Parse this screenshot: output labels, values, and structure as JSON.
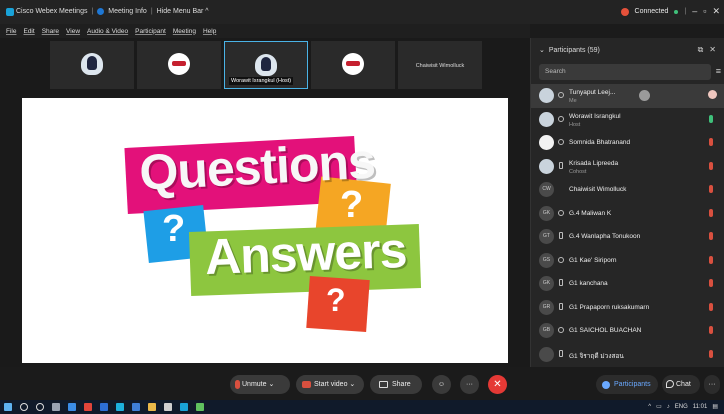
{
  "titlebar": {
    "app_title": "Cisco Webex Meetings",
    "meeting_info": "Meeting Info",
    "hide_menu": "Hide Menu Bar ^",
    "status": "Connected",
    "win_min": "–",
    "win_max": "▫",
    "win_close": "✕"
  },
  "menubar": [
    "File",
    "Edit",
    "Share",
    "View",
    "Audio & Video",
    "Participant",
    "Meeting",
    "Help"
  ],
  "video_strip": {
    "tiles": [
      {
        "kind": "person",
        "label": ""
      },
      {
        "kind": "logo",
        "label": ""
      },
      {
        "kind": "person",
        "label": "Worawit Israngkul  (Host)"
      },
      {
        "kind": "logo",
        "label": ""
      },
      {
        "kind": "name",
        "label": "Chaiwisit Wimolluck"
      }
    ]
  },
  "slide": {
    "word1": "Questions",
    "word2": "Answers",
    "mark": "?"
  },
  "participants": {
    "header": "Participants (59)",
    "search_placeholder": "Search",
    "items": [
      {
        "initials": "",
        "name": "Tunyaput Leej...",
        "sub": "Me",
        "avatar": "photo"
      },
      {
        "initials": "",
        "name": "Worawit Israngkul",
        "sub": "Host",
        "avatar": "photo"
      },
      {
        "initials": "",
        "name": "Somnida Bhatranand",
        "sub": "",
        "avatar": "logo"
      },
      {
        "initials": "",
        "name": "Krisada Lipreeda",
        "sub": "Cohost",
        "avatar": "photo"
      },
      {
        "initials": "CW",
        "name": "Chaiwisit Wimolluck",
        "sub": "",
        "avatar": "initials"
      },
      {
        "initials": "GK",
        "name": "G.4 Maliwan K",
        "sub": "",
        "avatar": "initials"
      },
      {
        "initials": "GT",
        "name": "G.4 Wanlapha Tonukoon",
        "sub": "",
        "avatar": "initials"
      },
      {
        "initials": "GS",
        "name": "G1 Kae' Siriporn",
        "sub": "",
        "avatar": "initials"
      },
      {
        "initials": "GK",
        "name": "G1 kanchana",
        "sub": "",
        "avatar": "initials"
      },
      {
        "initials": "GR",
        "name": "G1 Prapaporn ruksakumarn",
        "sub": "",
        "avatar": "initials"
      },
      {
        "initials": "GB",
        "name": "G1 SAICHOL BUACHAN",
        "sub": "",
        "avatar": "initials"
      },
      {
        "initials": "",
        "name": "G1 จิราฤดี ม่วงสอน",
        "sub": "",
        "avatar": "initials"
      }
    ]
  },
  "controls": {
    "unmute": "Unmute",
    "start_video": "Start video",
    "share": "Share",
    "more": "···",
    "end": "✕",
    "participants": "Participants",
    "chat": "Chat",
    "more_right": "···"
  },
  "taskbar": {
    "lang": "ENG",
    "time": "11:01"
  },
  "colors": {
    "accent": "#4ab3e6",
    "end_call": "#e53935",
    "muted": "#d9503f",
    "q_pink": "#e3117a",
    "a_green": "#8dc63f",
    "q_orange": "#f5a623",
    "q_blue": "#1e9ee6",
    "q_red": "#e8452c"
  }
}
